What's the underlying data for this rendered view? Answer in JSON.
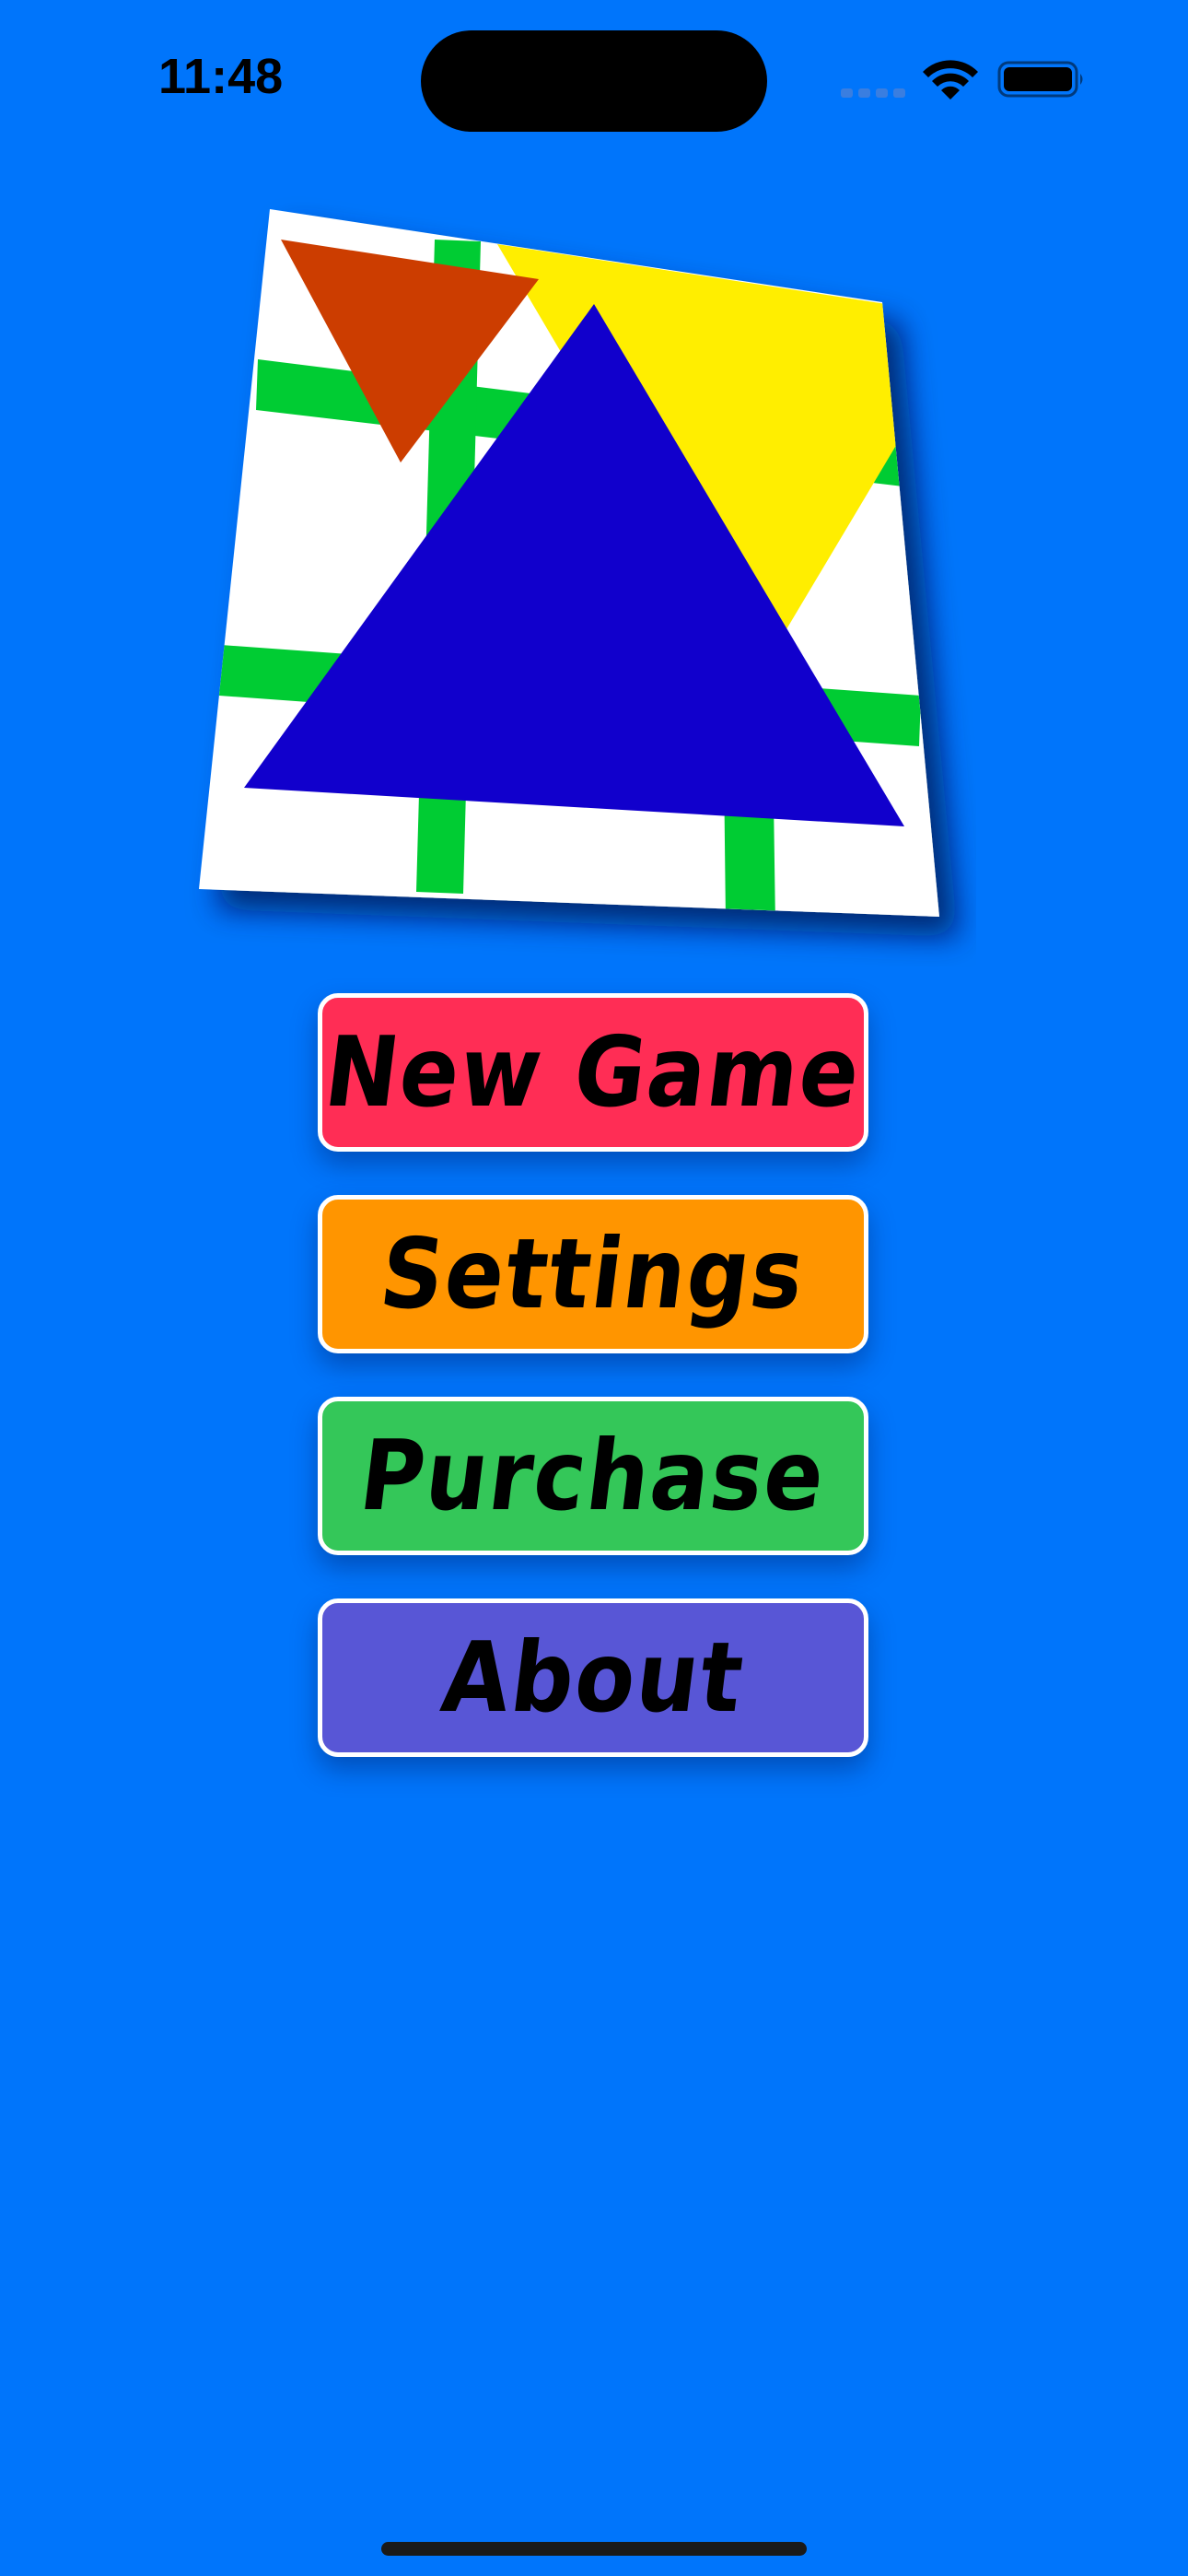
{
  "status_bar": {
    "time": "11:48",
    "icons": [
      "cellular-signal-icon",
      "wifi-icon",
      "battery-icon"
    ]
  },
  "logo": {
    "description_icon": "triangles-grid-logo",
    "colors": {
      "board": "#ffffff",
      "grid": "#00cc33",
      "orange_triangle": "#cc3d00",
      "yellow_triangle": "#ffee00",
      "blue_triangle": "#1100cc"
    }
  },
  "menu": {
    "new_game": "New Game",
    "settings": "Settings",
    "purchase": "Purchase",
    "about": "About"
  },
  "colors": {
    "background": "#0075fb",
    "new_game": "#ff2d55",
    "settings": "#ff9500",
    "purchase": "#34c759",
    "about": "#5856d6"
  }
}
